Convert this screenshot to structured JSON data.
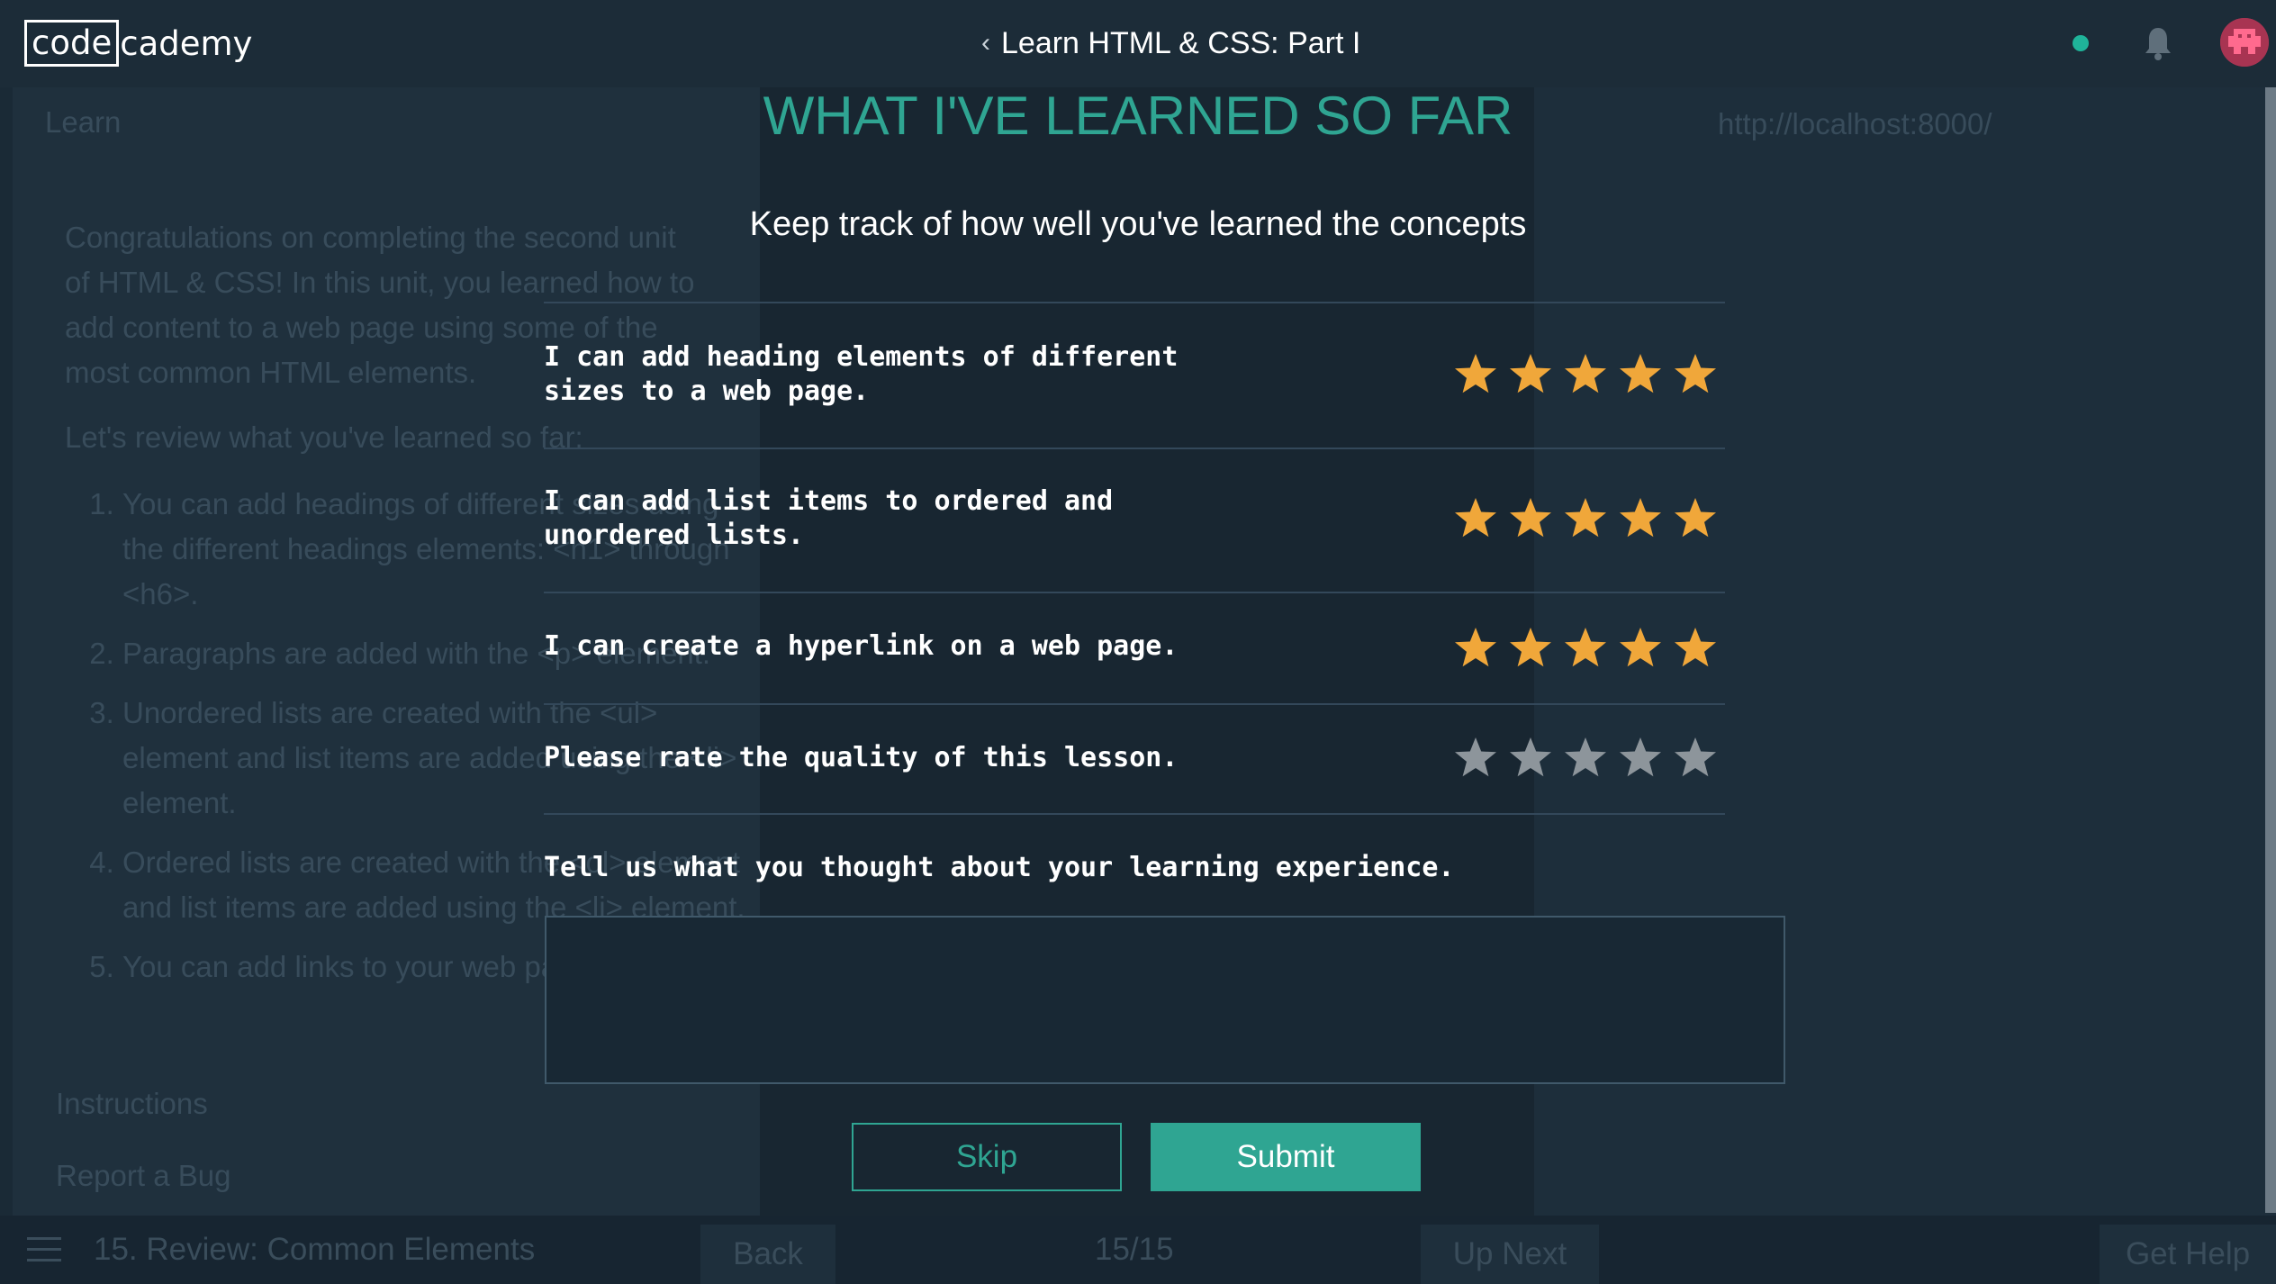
{
  "header": {
    "logo_code": "code",
    "logo_rest": "cademy",
    "course_title": "Learn HTML & CSS: Part I",
    "status_color": "#1fb49a"
  },
  "background": {
    "narrative_heading": "Learn",
    "browser_url": "http://localhost:8000/",
    "intro": "Congratulations on completing the second unit of HTML & CSS! In this unit, you learned how to add content to a web page using some of the most common HTML elements.",
    "review_intro": "Let's review what you've learned so far:",
    "points": [
      "You can add headings of different sizes using the different headings elements: <h1> through <h6>.",
      "Paragraphs are added with the <p> element.",
      "Unordered lists are created with the <ul> element and list items are added using the <li> element.",
      "Ordered lists are created with the <ol> element and list items are added using the <li> element.",
      "You can add links to your web page using"
    ],
    "instructions_label": "Instructions",
    "report_label": "Report a Bug"
  },
  "modal": {
    "title": "WHAT I'VE LEARNED SO FAR",
    "subtitle": "Keep track of how well you've learned the concepts",
    "ratings": [
      {
        "label": "I can add heading elements of different sizes to a web page.",
        "value": 5,
        "max": 5
      },
      {
        "label": "I can add list items to ordered and unordered lists.",
        "value": 5,
        "max": 5
      },
      {
        "label": "I can create a hyperlink on a web page.",
        "value": 5,
        "max": 5
      },
      {
        "label": "Please rate the quality of this lesson.",
        "value": 0,
        "max": 5
      }
    ],
    "feedback_label": "Tell us what you thought about your learning experience.",
    "feedback_value": "",
    "skip_label": "Skip",
    "submit_label": "Submit",
    "star_filled_color": "#f0a73a",
    "star_empty_color": "#8d959b",
    "accent_color": "#2fa592"
  },
  "bottom_bar": {
    "lesson": "15. Review: Common Elements",
    "back_label": "Back",
    "progress": "15/15",
    "next_label": "Up Next",
    "help_label": "Get Help"
  }
}
